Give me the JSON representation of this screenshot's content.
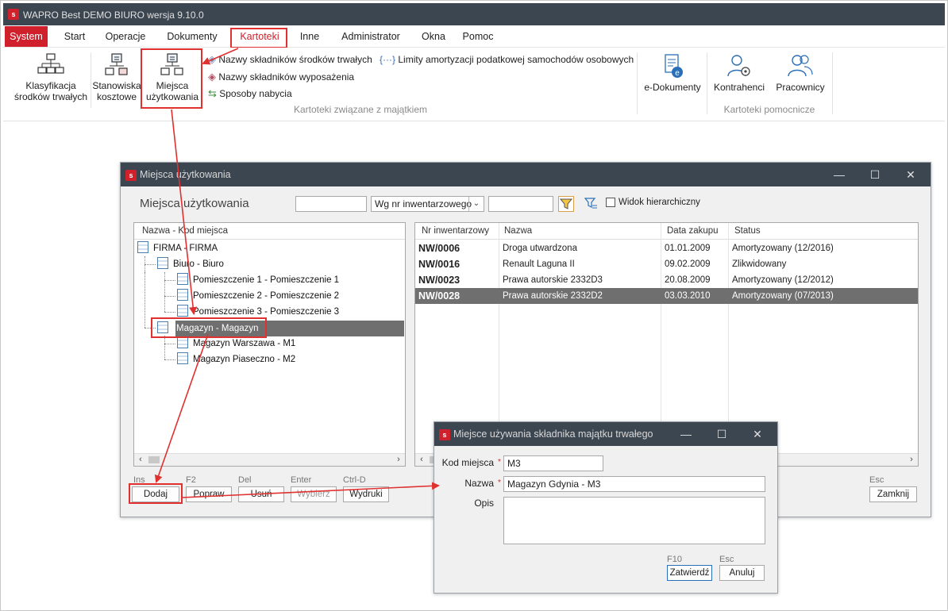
{
  "app": {
    "title": "WAPRO Best DEMO BIURO wersja 9.10.0",
    "logo_text": "s"
  },
  "menu": [
    "System",
    "Start",
    "Operacje",
    "Dokumenty",
    "Kartoteki",
    "Inne",
    "Administrator",
    "Okna",
    "Pomoc"
  ],
  "ribbon": {
    "btn_klasyfikacja": "Klasyfikacja\nśrodków trwałych",
    "btn_stanowiska": "Stanowiska\nkosztowe",
    "btn_miejsca": "Miejsca\nużytkowania",
    "link_nazwy_st": "Nazwy składników środków trwałych",
    "link_nazwy_wyp": "Nazwy składników wyposażenia",
    "link_sposoby": "Sposoby nabycia",
    "link_limity": "Limity amortyzacji podatkowej samochodów osobowych",
    "group_majatek": "Kartoteki związane z majątkiem",
    "btn_edokumenty": "e-Dokumenty",
    "btn_kontrahenci": "Kontrahenci",
    "btn_pracownicy": "Pracownicy",
    "group_pomocnicze": "Kartoteki pomocnicze"
  },
  "colors": {
    "accent": "#d0202c",
    "titlebar": "#3c4650",
    "highlight": "#e03030",
    "selected_row": "#6f6f6f"
  },
  "miejsca_window": {
    "title": "Miejsca użytkowania",
    "heading": "Miejsca użytkowania",
    "search1_value": "",
    "sort_select": "Wg nr inwentarzowego",
    "search2_value": "",
    "hier_label": "Widok hierarchiczny",
    "tree_header": "Nazwa - Kod miejsca",
    "tree": [
      {
        "label": "FIRMA - FIRMA",
        "level": 0
      },
      {
        "label": "Biuro - Biuro",
        "level": 1
      },
      {
        "label": "Pomieszczenie 1 - Pomieszczenie 1",
        "level": 2
      },
      {
        "label": "Pomieszczenie 2 - Pomieszczenie 2",
        "level": 2
      },
      {
        "label": "Pomieszczenie 3 - Pomieszczenie 3",
        "level": 2
      },
      {
        "label": "Magazyn - Magazyn",
        "level": 1,
        "selected": true
      },
      {
        "label": "Magazyn Warszawa - M1",
        "level": 2
      },
      {
        "label": "Magazyn Piaseczno - M2",
        "level": 2
      }
    ],
    "table": {
      "columns": [
        "Nr inwentarzowy",
        "Nazwa",
        "Data zakupu",
        "Status"
      ],
      "rows": [
        {
          "nr": "NW/0006",
          "nazwa": "Droga utwardzona",
          "data": "01.01.2009",
          "status": "Amortyzowany (12/2016)"
        },
        {
          "nr": "NW/0016",
          "nazwa": "Renault Laguna II",
          "data": "09.02.2009",
          "status": "Zlikwidowany"
        },
        {
          "nr": "NW/0023",
          "nazwa": "Prawa autorskie 2332D3",
          "data": "20.08.2009",
          "status": "Amortyzowany (12/2012)"
        },
        {
          "nr": "NW/0028",
          "nazwa": "Prawa autorskie 2332D2",
          "data": "03.03.2010",
          "status": "Amortyzowany (07/2013)",
          "selected": true
        }
      ]
    },
    "buttons": [
      {
        "hotkey": "Ins",
        "label": "Dodaj"
      },
      {
        "hotkey": "F2",
        "label": "Popraw"
      },
      {
        "hotkey": "Del",
        "label": "Usuń"
      },
      {
        "hotkey": "Enter",
        "label": "Wybierz"
      },
      {
        "hotkey": "Ctrl-D",
        "label": "Wydruki"
      }
    ],
    "close": {
      "hotkey": "Esc",
      "label": "Zamknij"
    }
  },
  "dialog": {
    "title": "Miejsce używania składnika majątku trwałego",
    "kod_label": "Kod miejsca",
    "kod_value": "M3",
    "nazwa_label": "Nazwa",
    "nazwa_value": "Magazyn Gdynia - M3",
    "opis_label": "Opis",
    "opis_value": "",
    "req_mark": "*",
    "ok": {
      "hotkey": "F10",
      "label": "Zatwierdź"
    },
    "cancel": {
      "hotkey": "Esc",
      "label": "Anuluj"
    }
  }
}
